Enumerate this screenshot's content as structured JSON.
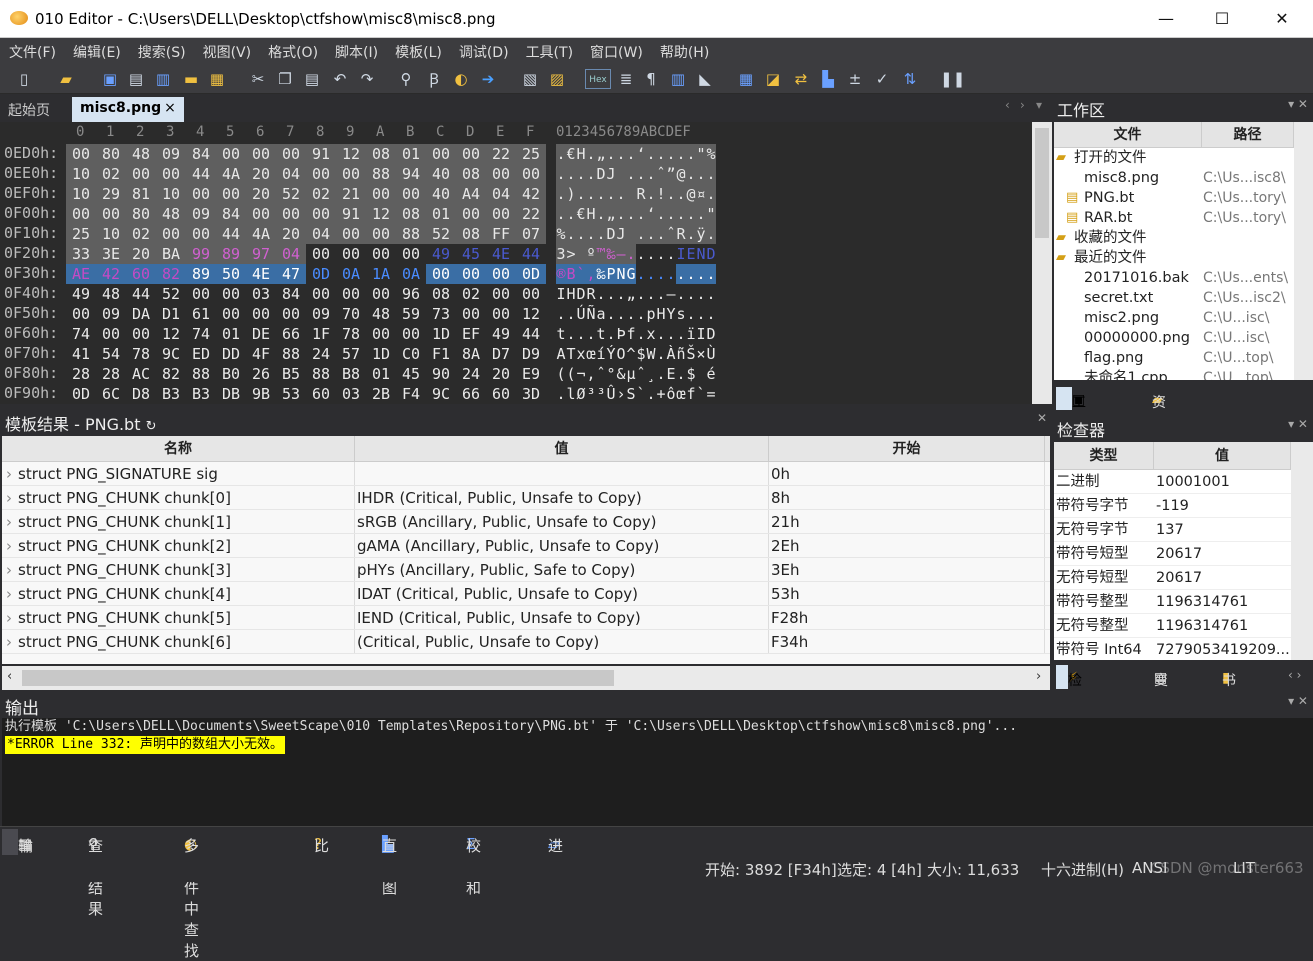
{
  "window": {
    "title": "010 Editor - C:\\Users\\DELL\\Desktop\\ctfshow\\misc8\\misc8.png",
    "minimize": "—",
    "maximize": "☐",
    "close": "✕"
  },
  "menu": [
    "文件(F)",
    "编辑(E)",
    "搜索(S)",
    "视图(V)",
    "格式(O)",
    "脚本(I)",
    "模板(L)",
    "调试(D)",
    "工具(T)",
    "窗口(W)",
    "帮助(H)"
  ],
  "toolbar_icons": [
    "new-file-icon",
    "open-folder-icon",
    "save-icon",
    "save-as-icon",
    "save-all-icon",
    "folder-icon",
    "open-multiple-icon",
    "cut-icon",
    "copy-icon",
    "paste-icon",
    "undo-icon",
    "redo-icon",
    "find-icon",
    "replace-icon",
    "find-in-files-icon",
    "goto-icon",
    "template-icon",
    "script-icon",
    "hex-icon",
    "format-icon",
    "pilcrow-icon",
    "columns-icon",
    "highlight-icon",
    "calculator-icon",
    "inspector-icon",
    "compare-icon",
    "histogram-icon",
    "checksum-icon",
    "hash-icon",
    "conversion-icon",
    "pause-icon"
  ],
  "toolbar_hex_label": "Hex",
  "tabs": {
    "start": "起始页",
    "file": "misc8.png",
    "close": "×"
  },
  "hex": {
    "header_hex": [
      "0",
      "1",
      "2",
      "3",
      "4",
      "5",
      "6",
      "7",
      "8",
      "9",
      "A",
      "B",
      "C",
      "D",
      "E",
      "F"
    ],
    "header_ascii": "0123456789ABCDEF",
    "rows": [
      {
        "addr": "0ED0h:",
        "bytes": [
          "00",
          "80",
          "48",
          "09",
          "84",
          "00",
          "00",
          "00",
          "91",
          "12",
          "08",
          "01",
          "00",
          "00",
          "22",
          "25"
        ],
        "ascii": ".€H.„...‘.....\"%"
      },
      {
        "addr": "0EE0h:",
        "bytes": [
          "10",
          "02",
          "00",
          "00",
          "44",
          "4A",
          "20",
          "04",
          "00",
          "00",
          "88",
          "94",
          "40",
          "08",
          "00",
          "00"
        ],
        "ascii": "....DJ ...ˆ”@..."
      },
      {
        "addr": "0EF0h:",
        "bytes": [
          "10",
          "29",
          "81",
          "10",
          "00",
          "00",
          "20",
          "52",
          "02",
          "21",
          "00",
          "00",
          "40",
          "A4",
          "04",
          "42"
        ],
        "ascii": ".)..... R.!..@¤.B"
      },
      {
        "addr": "0F00h:",
        "bytes": [
          "00",
          "00",
          "80",
          "48",
          "09",
          "84",
          "00",
          "00",
          "00",
          "91",
          "12",
          "08",
          "01",
          "00",
          "00",
          "22"
        ],
        "ascii": "..€H.„...‘.....\""
      },
      {
        "addr": "0F10h:",
        "bytes": [
          "25",
          "10",
          "02",
          "00",
          "00",
          "44",
          "4A",
          "20",
          "04",
          "00",
          "00",
          "88",
          "52",
          "08",
          "FF",
          "07"
        ],
        "ascii": "%....DJ ...ˆR.ÿ."
      },
      {
        "addr": "0F20h:",
        "bytes": [
          "33",
          "3E",
          "20",
          "BA",
          "99",
          "89",
          "97",
          "04",
          "00",
          "00",
          "00",
          "00",
          "49",
          "45",
          "4E",
          "44"
        ],
        "ascii": "3> º™‰—.....IEND"
      },
      {
        "addr": "0F30h:",
        "bytes": [
          "AE",
          "42",
          "60",
          "82",
          "89",
          "50",
          "4E",
          "47",
          "0D",
          "0A",
          "1A",
          "0A",
          "00",
          "00",
          "00",
          "0D"
        ],
        "ascii": "®B`‚‰PNG........"
      },
      {
        "addr": "0F40h:",
        "bytes": [
          "49",
          "48",
          "44",
          "52",
          "00",
          "00",
          "03",
          "84",
          "00",
          "00",
          "00",
          "96",
          "08",
          "02",
          "00",
          "00"
        ],
        "ascii": "IHDR...„...–...."
      },
      {
        "addr": "0F50h:",
        "bytes": [
          "00",
          "09",
          "DA",
          "D1",
          "61",
          "00",
          "00",
          "00",
          "09",
          "70",
          "48",
          "59",
          "73",
          "00",
          "00",
          "12"
        ],
        "ascii": "..ÚÑa....pHYs..."
      },
      {
        "addr": "0F60h:",
        "bytes": [
          "74",
          "00",
          "00",
          "12",
          "74",
          "01",
          "DE",
          "66",
          "1F",
          "78",
          "00",
          "00",
          "1D",
          "EF",
          "49",
          "44"
        ],
        "ascii": "t...t.Þf.x...ïID"
      },
      {
        "addr": "0F70h:",
        "bytes": [
          "41",
          "54",
          "78",
          "9C",
          "ED",
          "DD",
          "4F",
          "88",
          "24",
          "57",
          "1D",
          "C0",
          "F1",
          "8A",
          "D7",
          "D9"
        ],
        "ascii": "ATxœíÝO^$W.ÀñŠ×Ù"
      },
      {
        "addr": "0F80h:",
        "bytes": [
          "28",
          "28",
          "AC",
          "82",
          "88",
          "B0",
          "26",
          "B5",
          "88",
          "B8",
          "01",
          "45",
          "90",
          "24",
          "20",
          "E9"
        ],
        "ascii": "((¬‚ˆ°&µˆ¸.E.$ é"
      },
      {
        "addr": "0F90h:",
        "bytes": [
          "0D",
          "6C",
          "D8",
          "B3",
          "B3",
          "DB",
          "9B",
          "53",
          "60",
          "03",
          "2B",
          "F4",
          "9C",
          "66",
          "60",
          "3D"
        ],
        "ascii": ".lØ³³Û›S`.+ôœf`="
      }
    ]
  },
  "workspace": {
    "title": "工作区",
    "col_file": "文件",
    "col_path": "路径",
    "items": [
      {
        "name": "打开的文件",
        "path": "",
        "level": 0,
        "icon": "folder-open-icon"
      },
      {
        "name": "misc8.png",
        "path": "C:\\Us...isc8\\",
        "level": 1,
        "icon": ""
      },
      {
        "name": "PNG.bt",
        "path": "C:\\Us...tory\\",
        "level": 1,
        "icon": "template-file-icon"
      },
      {
        "name": "RAR.bt",
        "path": "C:\\Us...tory\\",
        "level": 1,
        "icon": "template-file-icon"
      },
      {
        "name": "收藏的文件",
        "path": "",
        "level": 0,
        "icon": "folder-open-icon"
      },
      {
        "name": "最近的文件",
        "path": "",
        "level": 0,
        "icon": "recent-folder-icon"
      },
      {
        "name": "20171016.bak",
        "path": "C:\\Us...ents\\",
        "level": 1,
        "icon": ""
      },
      {
        "name": "secret.txt",
        "path": "C:\\Us...isc2\\",
        "level": 1,
        "icon": ""
      },
      {
        "name": "misc2.png",
        "path": "C:\\U...isc\\",
        "level": 1,
        "icon": ""
      },
      {
        "name": "00000000.png",
        "path": "C:\\U...isc\\",
        "level": 1,
        "icon": ""
      },
      {
        "name": "flag.png",
        "path": "C:\\U...top\\",
        "level": 1,
        "icon": ""
      },
      {
        "name": "未命名1.cpp",
        "path": "C:\\U...top\\",
        "level": 1,
        "icon": ""
      }
    ],
    "tab_workspace": "工作区",
    "tab_explorer": "资源管理器"
  },
  "template": {
    "title": "模板结果 - PNG.bt",
    "col_name": "名称",
    "col_value": "值",
    "col_start": "开始",
    "rows": [
      {
        "name": "struct PNG_SIGNATURE sig",
        "value": "",
        "start": "0h"
      },
      {
        "name": "struct PNG_CHUNK chunk[0]",
        "value": "IHDR  (Critical, Public, Unsafe to Copy)",
        "start": "8h"
      },
      {
        "name": "struct PNG_CHUNK chunk[1]",
        "value": "sRGB  (Ancillary, Public, Unsafe to Copy)",
        "start": "21h"
      },
      {
        "name": "struct PNG_CHUNK chunk[2]",
        "value": "gAMA  (Ancillary, Public, Unsafe to Copy)",
        "start": "2Eh"
      },
      {
        "name": "struct PNG_CHUNK chunk[3]",
        "value": "pHYs  (Ancillary, Public, Safe to Copy)",
        "start": "3Eh"
      },
      {
        "name": "struct PNG_CHUNK chunk[4]",
        "value": "IDAT  (Critical, Public, Unsafe to Copy)",
        "start": "53h"
      },
      {
        "name": "struct PNG_CHUNK chunk[5]",
        "value": "IEND  (Critical, Public, Unsafe to Copy)",
        "start": "F28h"
      },
      {
        "name": "struct PNG_CHUNK chunk[6]",
        "value": "        (Critical, Public, Unsafe to Copy)",
        "start": "F34h"
      }
    ]
  },
  "inspector": {
    "title": "检查器",
    "col_type": "类型",
    "col_value": "值",
    "rows": [
      {
        "type": "二进制",
        "value": "10001001"
      },
      {
        "type": "带符号字节",
        "value": "-119"
      },
      {
        "type": "无符号字节",
        "value": "137"
      },
      {
        "type": "带符号短型",
        "value": "20617"
      },
      {
        "type": "无符号短型",
        "value": "20617"
      },
      {
        "type": "带符号整型",
        "value": "1196314761"
      },
      {
        "type": "无符号整型",
        "value": "1196314761"
      },
      {
        "type": "带符号 Int64",
        "value": "7279053419209..."
      }
    ],
    "tab_inspector": "检查器",
    "tab_variables": "变量",
    "tab_bookmarks": "书签"
  },
  "output": {
    "title": "输出",
    "line1": "执行模板 'C:\\Users\\DELL\\Documents\\SweetScape\\010 Templates\\Repository\\PNG.bt' 于 'C:\\Users\\DELL\\Desktop\\ctfshow\\misc8\\misc8.png'...",
    "error": "*ERROR Line 332: 声明中的数组大小无效。"
  },
  "bottom_tabs": [
    "输出",
    "查找结果",
    "多文件中查找",
    "比较",
    "直方图",
    "校验和",
    "进程"
  ],
  "status": {
    "start": "开始: 3892 [F34h]",
    "selected": "选定: 4 [4h]",
    "size": "大小: 11,633",
    "mode": "十六进制(H)",
    "encoding": "ANSI",
    "misc": "LIT",
    "watermark": "CSDN @monster663"
  },
  "colors": {
    "hex_bg": "#2b2b2b",
    "selected_gray": "#5f5f5f",
    "magenta": "#c000c0",
    "navy": "#1f2c8a",
    "selection_blue": "#3a6ea5",
    "error_yellow": "#ffff00"
  }
}
